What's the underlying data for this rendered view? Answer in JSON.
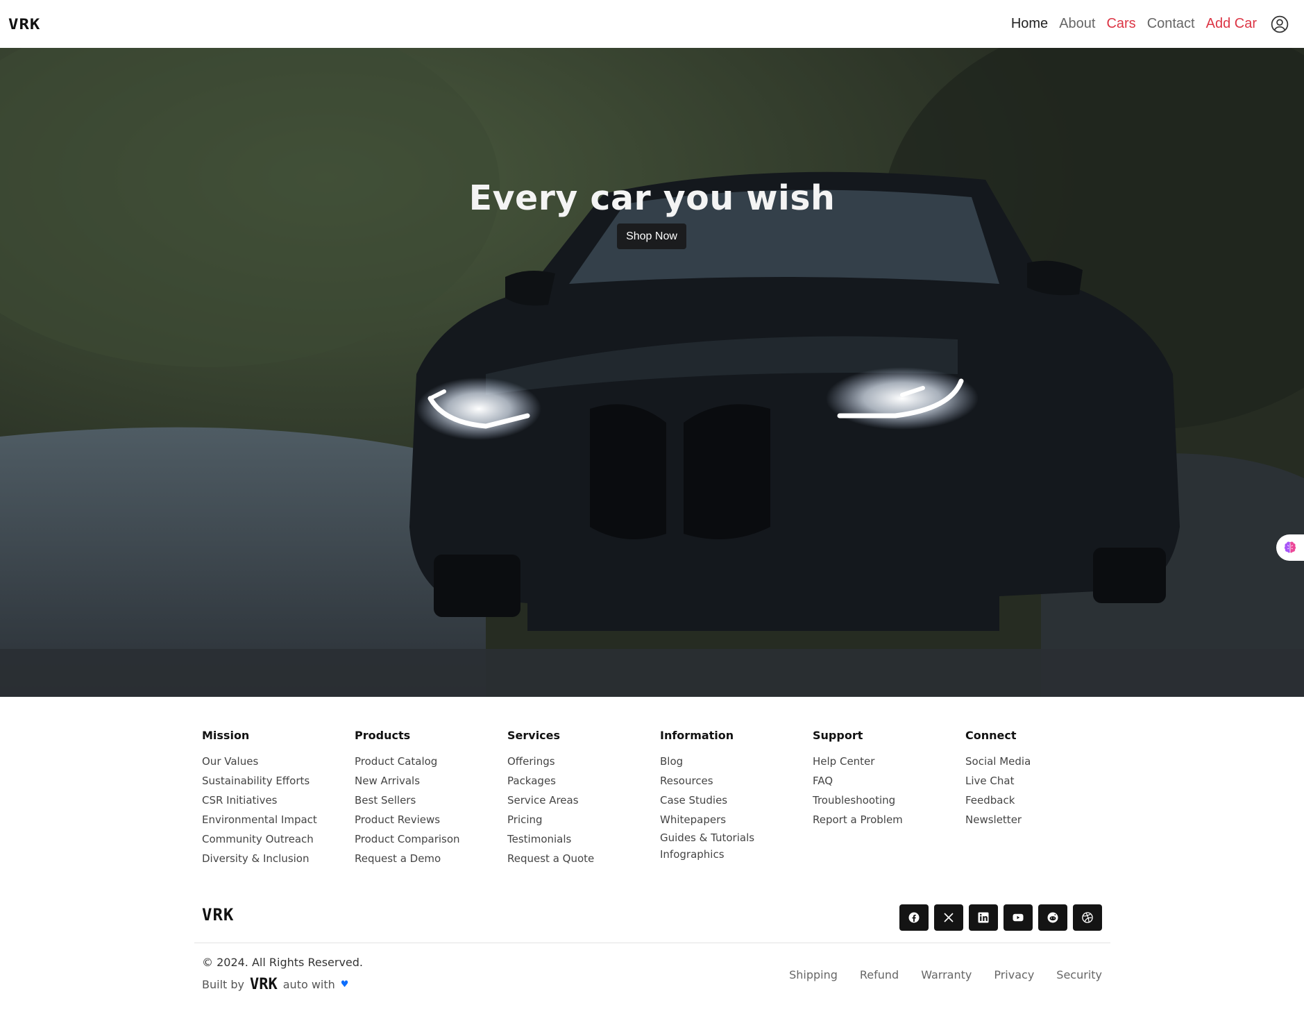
{
  "navbar": {
    "logo": "VRK",
    "links": [
      {
        "label": "Home"
      },
      {
        "label": "About"
      },
      {
        "label": "Cars"
      },
      {
        "label": "Contact"
      },
      {
        "label": "Add Car"
      }
    ],
    "user_icon": "user-circle-icon"
  },
  "hero": {
    "title": "Every car you wish",
    "cta_label": "Shop Now",
    "side_widget_icon": "brain-icon"
  },
  "footer": {
    "columns": [
      {
        "title": "Mission",
        "items": [
          "Our Values",
          "Sustainability Efforts",
          "CSR Initiatives",
          "Environmental Impact",
          "Community Outreach",
          "Diversity & Inclusion"
        ]
      },
      {
        "title": "Products",
        "items": [
          "Product Catalog",
          "New Arrivals",
          "Best Sellers",
          "Product Reviews",
          "Product Comparison",
          "Request a Demo"
        ]
      },
      {
        "title": "Services",
        "items": [
          "Offerings",
          "Packages",
          "Service Areas",
          "Pricing",
          "Testimonials",
          "Request a Quote"
        ]
      },
      {
        "title": "Information",
        "items": [
          "Blog",
          "Resources",
          "Case Studies",
          "Whitepapers",
          "Guides & Tutorials",
          "Infographics"
        ]
      },
      {
        "title": "Support",
        "items": [
          "Help Center",
          "FAQ",
          "Troubleshooting",
          "Report a Problem"
        ]
      },
      {
        "title": "Connect",
        "items": [
          "Social Media",
          "Live Chat",
          "Feedback",
          "Newsletter"
        ]
      }
    ],
    "logo": "VRK",
    "socials": [
      "facebook-icon",
      "x-icon",
      "linkedin-icon",
      "youtube-icon",
      "reddit-icon",
      "dribbble-icon"
    ],
    "copyright": "© 2024. All Rights Reserved.",
    "built_by_prefix": "Built by",
    "built_by_logo": "VRK",
    "built_by_suffix": "auto with",
    "legal_links": [
      "Shipping",
      "Refund",
      "Warranty",
      "Privacy",
      "Security"
    ]
  },
  "colors": {
    "accent_red": "#dc3545",
    "button_dark": "#1b1c1e",
    "heart_blue": "#0d6efd"
  }
}
